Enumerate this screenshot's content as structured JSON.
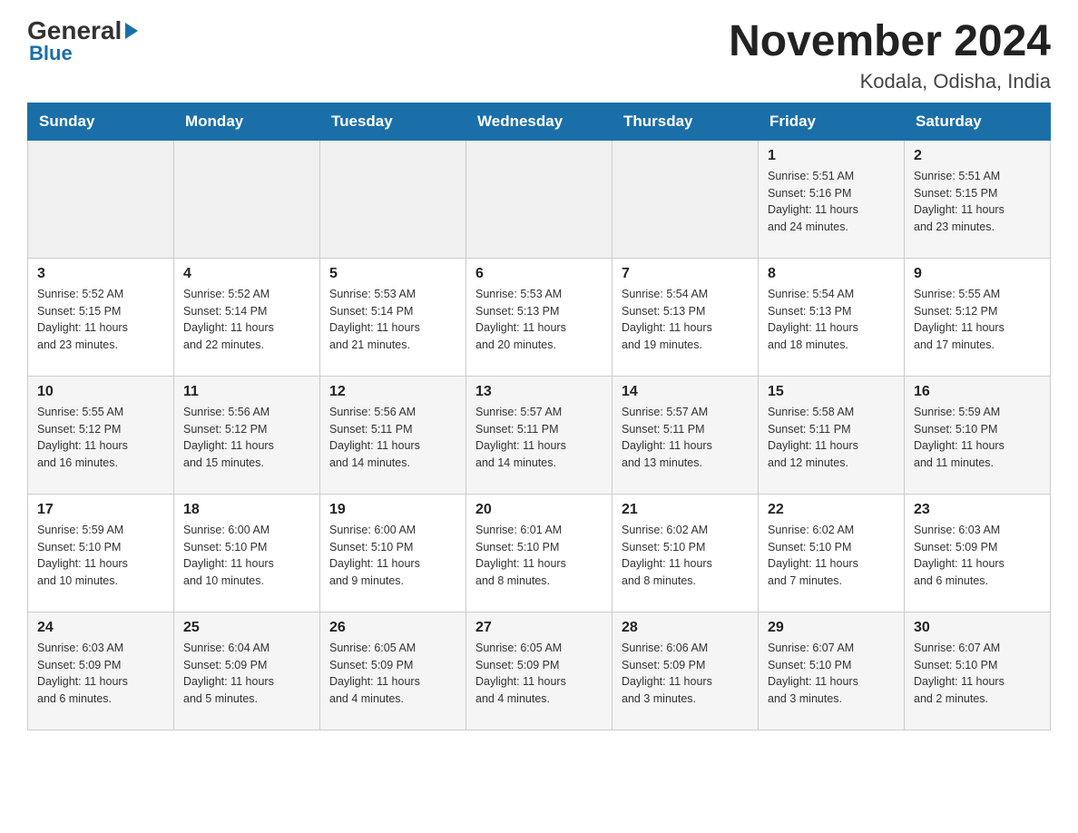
{
  "header": {
    "logo_general": "General",
    "logo_blue": "Blue",
    "month_title": "November 2024",
    "location": "Kodala, Odisha, India"
  },
  "days_of_week": [
    "Sunday",
    "Monday",
    "Tuesday",
    "Wednesday",
    "Thursday",
    "Friday",
    "Saturday"
  ],
  "weeks": [
    {
      "days": [
        {
          "number": "",
          "info": ""
        },
        {
          "number": "",
          "info": ""
        },
        {
          "number": "",
          "info": ""
        },
        {
          "number": "",
          "info": ""
        },
        {
          "number": "",
          "info": ""
        },
        {
          "number": "1",
          "info": "Sunrise: 5:51 AM\nSunset: 5:16 PM\nDaylight: 11 hours\nand 24 minutes."
        },
        {
          "number": "2",
          "info": "Sunrise: 5:51 AM\nSunset: 5:15 PM\nDaylight: 11 hours\nand 23 minutes."
        }
      ]
    },
    {
      "days": [
        {
          "number": "3",
          "info": "Sunrise: 5:52 AM\nSunset: 5:15 PM\nDaylight: 11 hours\nand 23 minutes."
        },
        {
          "number": "4",
          "info": "Sunrise: 5:52 AM\nSunset: 5:14 PM\nDaylight: 11 hours\nand 22 minutes."
        },
        {
          "number": "5",
          "info": "Sunrise: 5:53 AM\nSunset: 5:14 PM\nDaylight: 11 hours\nand 21 minutes."
        },
        {
          "number": "6",
          "info": "Sunrise: 5:53 AM\nSunset: 5:13 PM\nDaylight: 11 hours\nand 20 minutes."
        },
        {
          "number": "7",
          "info": "Sunrise: 5:54 AM\nSunset: 5:13 PM\nDaylight: 11 hours\nand 19 minutes."
        },
        {
          "number": "8",
          "info": "Sunrise: 5:54 AM\nSunset: 5:13 PM\nDaylight: 11 hours\nand 18 minutes."
        },
        {
          "number": "9",
          "info": "Sunrise: 5:55 AM\nSunset: 5:12 PM\nDaylight: 11 hours\nand 17 minutes."
        }
      ]
    },
    {
      "days": [
        {
          "number": "10",
          "info": "Sunrise: 5:55 AM\nSunset: 5:12 PM\nDaylight: 11 hours\nand 16 minutes."
        },
        {
          "number": "11",
          "info": "Sunrise: 5:56 AM\nSunset: 5:12 PM\nDaylight: 11 hours\nand 15 minutes."
        },
        {
          "number": "12",
          "info": "Sunrise: 5:56 AM\nSunset: 5:11 PM\nDaylight: 11 hours\nand 14 minutes."
        },
        {
          "number": "13",
          "info": "Sunrise: 5:57 AM\nSunset: 5:11 PM\nDaylight: 11 hours\nand 14 minutes."
        },
        {
          "number": "14",
          "info": "Sunrise: 5:57 AM\nSunset: 5:11 PM\nDaylight: 11 hours\nand 13 minutes."
        },
        {
          "number": "15",
          "info": "Sunrise: 5:58 AM\nSunset: 5:11 PM\nDaylight: 11 hours\nand 12 minutes."
        },
        {
          "number": "16",
          "info": "Sunrise: 5:59 AM\nSunset: 5:10 PM\nDaylight: 11 hours\nand 11 minutes."
        }
      ]
    },
    {
      "days": [
        {
          "number": "17",
          "info": "Sunrise: 5:59 AM\nSunset: 5:10 PM\nDaylight: 11 hours\nand 10 minutes."
        },
        {
          "number": "18",
          "info": "Sunrise: 6:00 AM\nSunset: 5:10 PM\nDaylight: 11 hours\nand 10 minutes."
        },
        {
          "number": "19",
          "info": "Sunrise: 6:00 AM\nSunset: 5:10 PM\nDaylight: 11 hours\nand 9 minutes."
        },
        {
          "number": "20",
          "info": "Sunrise: 6:01 AM\nSunset: 5:10 PM\nDaylight: 11 hours\nand 8 minutes."
        },
        {
          "number": "21",
          "info": "Sunrise: 6:02 AM\nSunset: 5:10 PM\nDaylight: 11 hours\nand 8 minutes."
        },
        {
          "number": "22",
          "info": "Sunrise: 6:02 AM\nSunset: 5:10 PM\nDaylight: 11 hours\nand 7 minutes."
        },
        {
          "number": "23",
          "info": "Sunrise: 6:03 AM\nSunset: 5:09 PM\nDaylight: 11 hours\nand 6 minutes."
        }
      ]
    },
    {
      "days": [
        {
          "number": "24",
          "info": "Sunrise: 6:03 AM\nSunset: 5:09 PM\nDaylight: 11 hours\nand 6 minutes."
        },
        {
          "number": "25",
          "info": "Sunrise: 6:04 AM\nSunset: 5:09 PM\nDaylight: 11 hours\nand 5 minutes."
        },
        {
          "number": "26",
          "info": "Sunrise: 6:05 AM\nSunset: 5:09 PM\nDaylight: 11 hours\nand 4 minutes."
        },
        {
          "number": "27",
          "info": "Sunrise: 6:05 AM\nSunset: 5:09 PM\nDaylight: 11 hours\nand 4 minutes."
        },
        {
          "number": "28",
          "info": "Sunrise: 6:06 AM\nSunset: 5:09 PM\nDaylight: 11 hours\nand 3 minutes."
        },
        {
          "number": "29",
          "info": "Sunrise: 6:07 AM\nSunset: 5:10 PM\nDaylight: 11 hours\nand 3 minutes."
        },
        {
          "number": "30",
          "info": "Sunrise: 6:07 AM\nSunset: 5:10 PM\nDaylight: 11 hours\nand 2 minutes."
        }
      ]
    }
  ]
}
